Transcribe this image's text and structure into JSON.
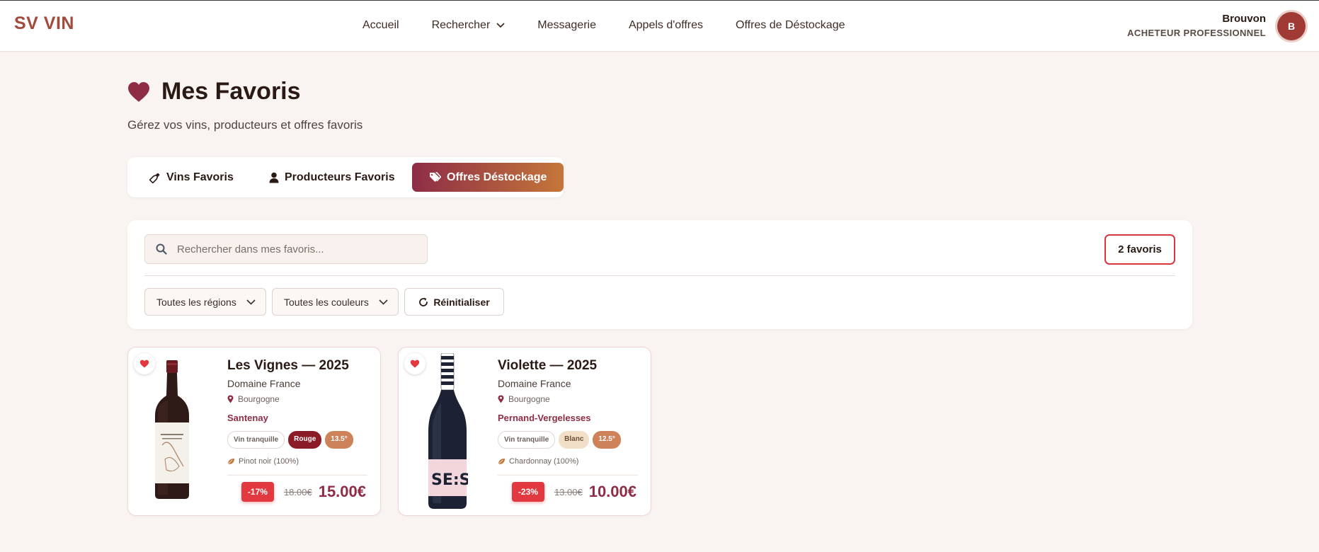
{
  "brand": {
    "logo": "SV VIN"
  },
  "nav": {
    "items": [
      "Accueil",
      "Rechercher",
      "Messagerie",
      "Appels d'offres",
      "Offres de Déstockage"
    ]
  },
  "user": {
    "name": "Brouvon",
    "role": "ACHETEUR PROFESSIONNEL",
    "initial": "B"
  },
  "page": {
    "title": "Mes Favoris",
    "subtitle": "Gérez vos vins, producteurs et offres favoris"
  },
  "tabs": {
    "wines": "Vins Favoris",
    "producers": "Producteurs Favoris",
    "offers": "Offres Déstockage",
    "active": "offers"
  },
  "filters": {
    "search_placeholder": "Rechercher dans mes favoris...",
    "search_value": "",
    "count": "2 favoris",
    "region": "Toutes les régions",
    "color": "Toutes les couleurs",
    "reset": "Réinitialiser"
  },
  "cards": [
    {
      "name": "Les Vignes — 2025",
      "producer": "Domaine France",
      "region": "Bourgogne",
      "appellation": "Santenay",
      "type": "Vin tranquille",
      "color": "Rouge",
      "abv": "13.5°",
      "grape": "Pinot noir (100%)",
      "discount": "-17%",
      "old_price": "18.00€",
      "price": "15.00€",
      "favorite": true
    },
    {
      "name": "Violette — 2025",
      "producer": "Domaine France",
      "region": "Bourgogne",
      "appellation": "Pernand-Vergelesses",
      "type": "Vin tranquille",
      "color": "Blanc",
      "abv": "12.5°",
      "grape": "Chardonnay (100%)",
      "discount": "-23%",
      "old_price": "13.00€",
      "price": "10.00€",
      "favorite": true
    }
  ],
  "colors": {
    "accent": "#8e2c46",
    "brand": "#a24a3b",
    "gradient_end": "#c4773a",
    "danger": "#e1393f",
    "background": "#f9f4f1"
  },
  "icons": {
    "title": "heart-icon",
    "nav_dropdown": "chevron-down-icon",
    "tab_wines": "wine-bottle-icon",
    "tab_producers": "user-icon",
    "tab_offers": "tags-icon",
    "search": "search-icon",
    "reset": "rotate-icon",
    "region": "map-pin-icon",
    "grape": "leaf-icon",
    "favorite": "heart-icon"
  }
}
